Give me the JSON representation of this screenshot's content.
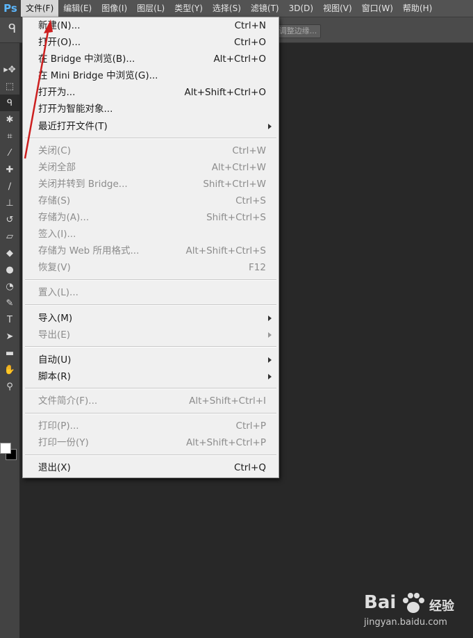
{
  "app": {
    "logo": "Ps"
  },
  "menubar": [
    {
      "label": "文件(F)",
      "active": true
    },
    {
      "label": "编辑(E)"
    },
    {
      "label": "图像(I)"
    },
    {
      "label": "图层(L)"
    },
    {
      "label": "类型(Y)"
    },
    {
      "label": "选择(S)"
    },
    {
      "label": "滤镜(T)"
    },
    {
      "label": "3D(D)"
    },
    {
      "label": "视图(V)"
    },
    {
      "label": "窗口(W)"
    },
    {
      "label": "帮助(H)"
    }
  ],
  "options_bar": {
    "refine_edge_label": "调整边缘..."
  },
  "file_menu": {
    "items": [
      {
        "label": "新建(N)...",
        "shortcut": "Ctrl+N",
        "enabled": true
      },
      {
        "label": "打开(O)...",
        "shortcut": "Ctrl+O",
        "enabled": true
      },
      {
        "label": "在 Bridge 中浏览(B)...",
        "shortcut": "Alt+Ctrl+O",
        "enabled": true
      },
      {
        "label": "在 Mini Bridge 中浏览(G)...",
        "shortcut": "",
        "enabled": true
      },
      {
        "label": "打开为...",
        "shortcut": "Alt+Shift+Ctrl+O",
        "enabled": true
      },
      {
        "label": "打开为智能对象...",
        "shortcut": "",
        "enabled": true
      },
      {
        "label": "最近打开文件(T)",
        "shortcut": "",
        "enabled": true,
        "submenu": true
      },
      {
        "label": "关闭(C)",
        "shortcut": "Ctrl+W",
        "enabled": false
      },
      {
        "label": "关闭全部",
        "shortcut": "Alt+Ctrl+W",
        "enabled": false
      },
      {
        "label": "关闭并转到 Bridge...",
        "shortcut": "Shift+Ctrl+W",
        "enabled": false
      },
      {
        "label": "存储(S)",
        "shortcut": "Ctrl+S",
        "enabled": false
      },
      {
        "label": "存储为(A)...",
        "shortcut": "Shift+Ctrl+S",
        "enabled": false
      },
      {
        "label": "签入(I)...",
        "shortcut": "",
        "enabled": false
      },
      {
        "label": "存储为 Web 所用格式...",
        "shortcut": "Alt+Shift+Ctrl+S",
        "enabled": false
      },
      {
        "label": "恢复(V)",
        "shortcut": "F12",
        "enabled": false
      },
      {
        "label": "置入(L)...",
        "shortcut": "",
        "enabled": false
      },
      {
        "label": "导入(M)",
        "shortcut": "",
        "enabled": true,
        "submenu": true
      },
      {
        "label": "导出(E)",
        "shortcut": "",
        "enabled": false,
        "submenu": true
      },
      {
        "label": "自动(U)",
        "shortcut": "",
        "enabled": true,
        "submenu": true
      },
      {
        "label": "脚本(R)",
        "shortcut": "",
        "enabled": true,
        "submenu": true
      },
      {
        "label": "文件简介(F)...",
        "shortcut": "Alt+Shift+Ctrl+I",
        "enabled": false
      },
      {
        "label": "打印(P)...",
        "shortcut": "Ctrl+P",
        "enabled": false
      },
      {
        "label": "打印一份(Y)",
        "shortcut": "Alt+Shift+Ctrl+P",
        "enabled": false
      },
      {
        "label": "退出(X)",
        "shortcut": "Ctrl+Q",
        "enabled": true
      }
    ]
  },
  "tools": [
    "move-icon",
    "marquee-icon",
    "lasso-icon",
    "magic-wand-icon",
    "crop-icon",
    "eyedropper-icon",
    "healing-brush-icon",
    "brush-icon",
    "clone-stamp-icon",
    "history-brush-icon",
    "eraser-icon",
    "paint-bucket-icon",
    "blur-icon",
    "dodge-icon",
    "pen-icon",
    "type-icon",
    "path-selection-icon",
    "rectangle-icon",
    "hand-icon",
    "zoom-icon"
  ],
  "tool_glyphs": {
    "type-icon": "T"
  },
  "colors": {
    "menubar_bg": "#535353",
    "menu_bg": "#f0f0f0",
    "canvas_bg": "#282828",
    "annotation_arrow": "#cc1f1f",
    "ps_blue": "#5cb7ff"
  },
  "watermark": {
    "brand": "Bai",
    "cn": "经验",
    "url": "jingyan.baidu.com"
  }
}
